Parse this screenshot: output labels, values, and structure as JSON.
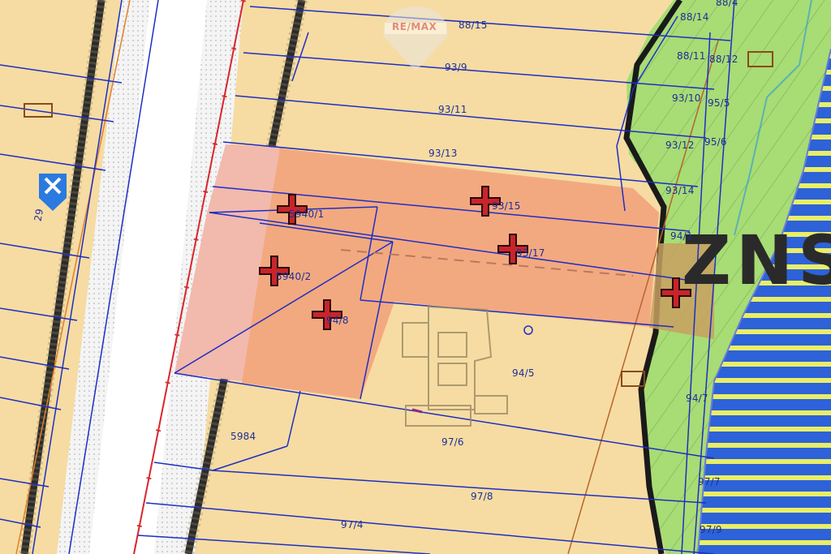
{
  "watermark": {
    "brand": "RE/MAX",
    "accent": "#d44a3a"
  },
  "zone_marker": "ZNS",
  "colors": {
    "land": "#f6dca2",
    "plot_selected": "#f3a97f",
    "plot_selected_light": "#f2b9ad",
    "green_zone": "#a8dc74",
    "water": "#2d62d8",
    "water_stripes": "#e9ee67",
    "boundary": "#1e2ec4",
    "marker": "#c8252a"
  },
  "parcels": [
    {
      "id": "p-88-15",
      "label": "88/15"
    },
    {
      "id": "p-88-14",
      "label": "88/14"
    },
    {
      "id": "p-88-4",
      "label": "88/4"
    },
    {
      "id": "p-88-11",
      "label": "88/11"
    },
    {
      "id": "p-88-12",
      "label": "88/12"
    },
    {
      "id": "p-93-9",
      "label": "93/9"
    },
    {
      "id": "p-93-11",
      "label": "93/11"
    },
    {
      "id": "p-93-10",
      "label": "93/10"
    },
    {
      "id": "p-95-5",
      "label": "95/5"
    },
    {
      "id": "p-93-13",
      "label": "93/13"
    },
    {
      "id": "p-93-12",
      "label": "93/12"
    },
    {
      "id": "p-95-6",
      "label": "95/6"
    },
    {
      "id": "p-93-14",
      "label": "93/14"
    },
    {
      "id": "p-93-15",
      "label": "93/15"
    },
    {
      "id": "p-94-1",
      "label": "94/1"
    },
    {
      "id": "p-5940-1",
      "label": "5940/1"
    },
    {
      "id": "p-93-17",
      "label": "93/17"
    },
    {
      "id": "p-5940-2",
      "label": "5940/2"
    },
    {
      "id": "p-94-8",
      "label": "94/8"
    },
    {
      "id": "p-94-5",
      "label": "94/5"
    },
    {
      "id": "p-94-7",
      "label": "94/7"
    },
    {
      "id": "p-5984",
      "label": "5984"
    },
    {
      "id": "p-97-6",
      "label": "97/6"
    },
    {
      "id": "p-97-8",
      "label": "97/8"
    },
    {
      "id": "p-97-4",
      "label": "97/4"
    },
    {
      "id": "p-97-7",
      "label": "97/7"
    },
    {
      "id": "p-97-9",
      "label": "97/9"
    },
    {
      "id": "p-29",
      "label": "29"
    }
  ]
}
